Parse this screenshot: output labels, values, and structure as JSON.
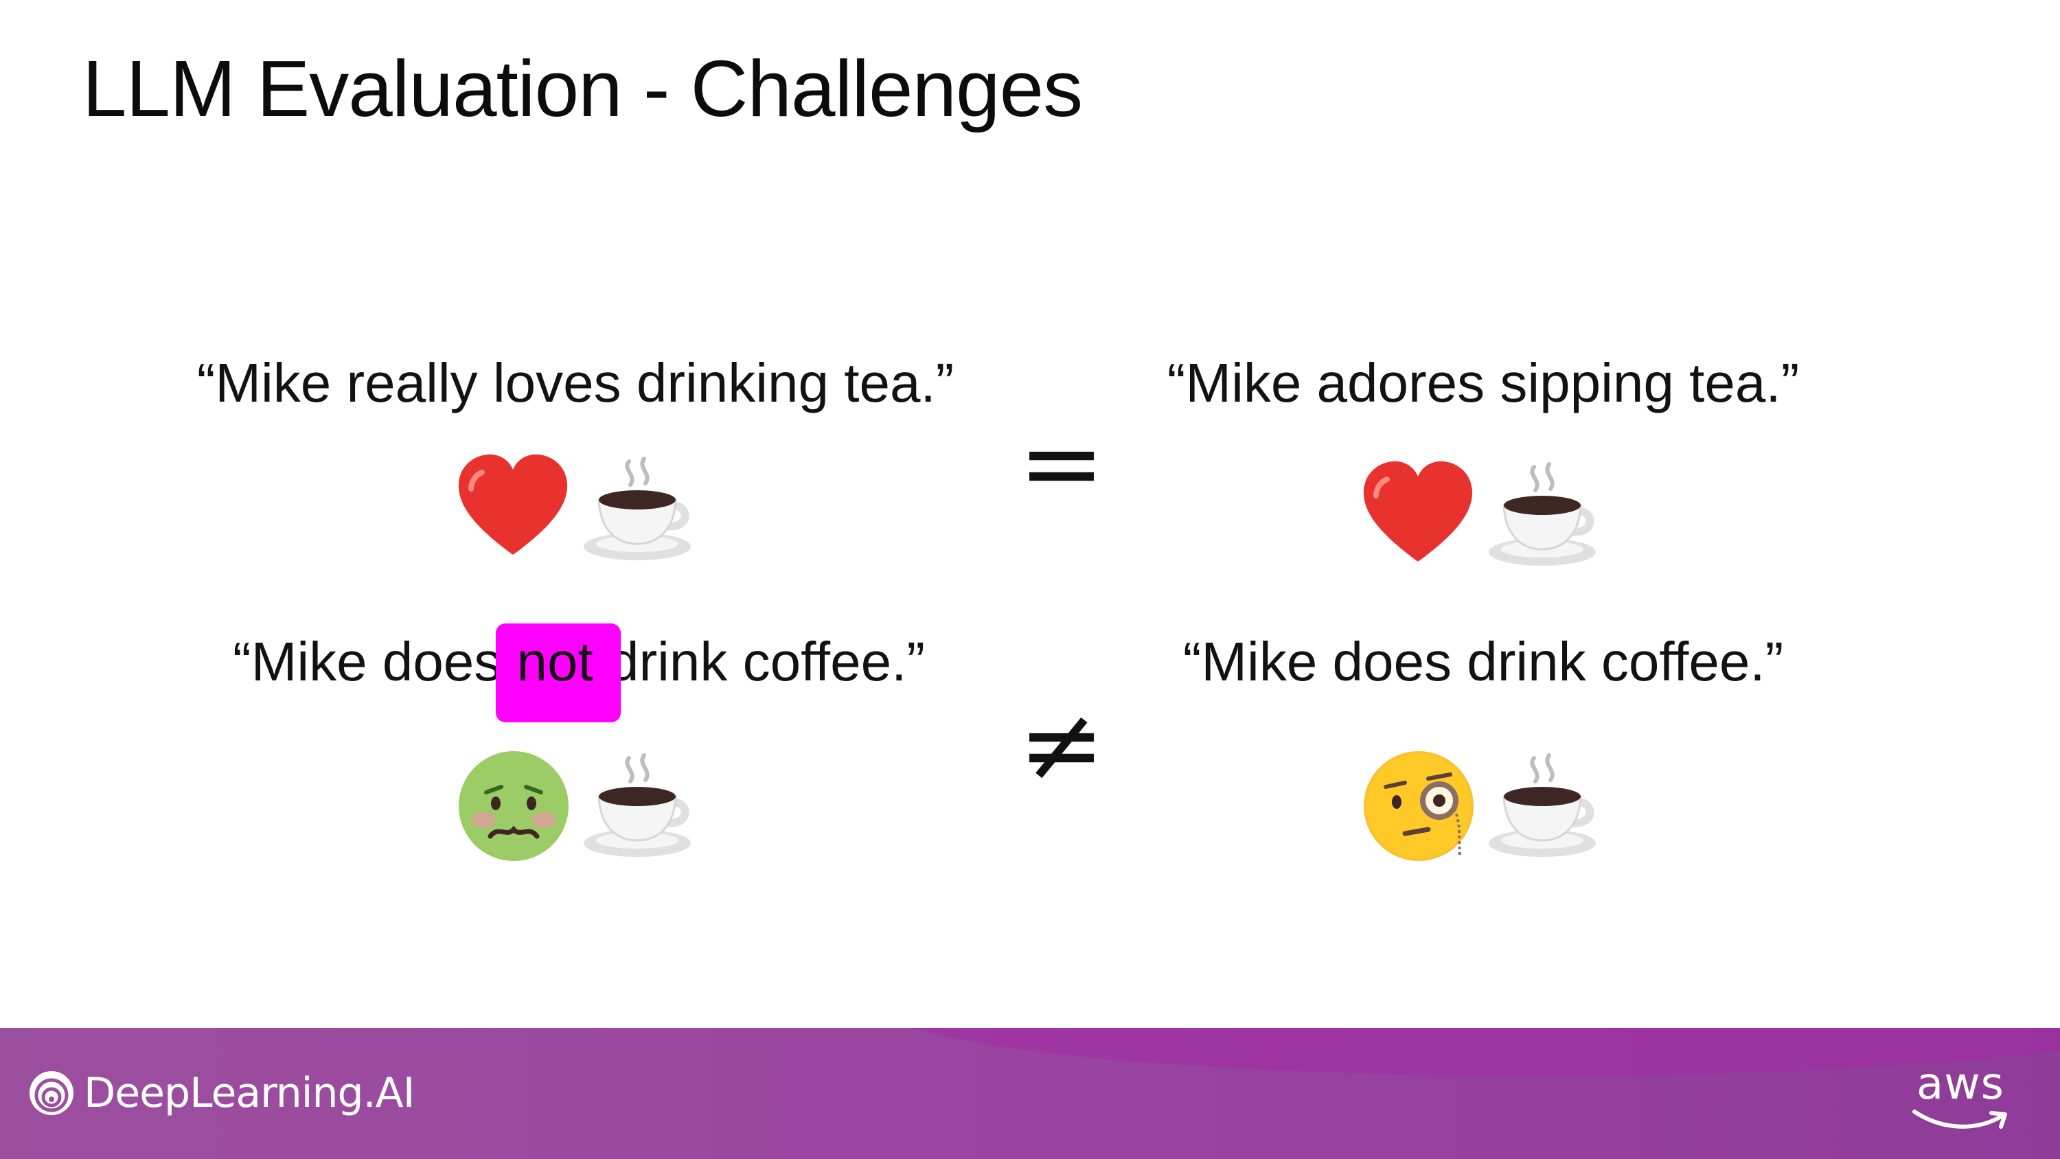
{
  "slide": {
    "title": "LLM Evaluation - Challenges"
  },
  "examples": [
    {
      "left_sentence": "“Mike really loves drinking tea.”",
      "left_emojis": [
        "heart-icon",
        "coffee-cup-icon"
      ],
      "operator": "=",
      "right_sentence": "“Mike adores sipping tea.”",
      "right_emojis": [
        "heart-icon",
        "coffee-cup-icon"
      ]
    },
    {
      "left_sentence_pre": "“Mike does ",
      "left_sentence_highlight": "not",
      "left_sentence_post": " drink coffee.”",
      "left_emojis": [
        "nauseated-face-icon",
        "coffee-cup-icon"
      ],
      "operator": "≠",
      "right_sentence": "“Mike does drink coffee.”",
      "right_emojis": [
        "monocle-face-icon",
        "coffee-cup-icon"
      ]
    }
  ],
  "colors": {
    "highlight": "#ff00ff",
    "footer_start": "#9b4f9f",
    "footer_end": "#8f3c99",
    "heart": "#e8322e"
  },
  "footer": {
    "brand": "DeepLearning.AI",
    "partner": "aws"
  }
}
